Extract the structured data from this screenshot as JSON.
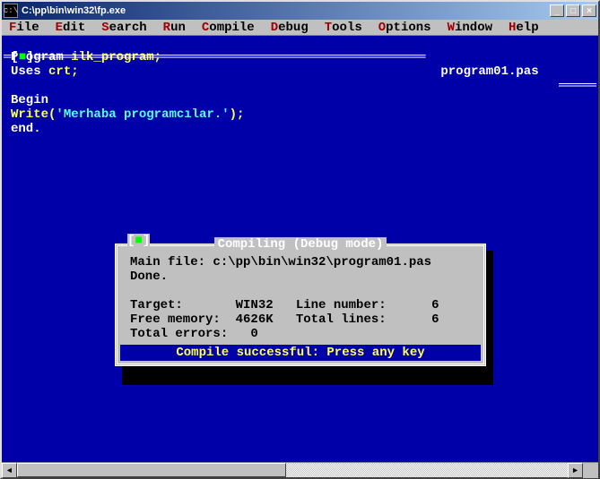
{
  "window": {
    "title": "C:\\pp\\bin\\win32\\fp.exe",
    "icon_label": "c:\\"
  },
  "menu": [
    {
      "hotkey": "F",
      "rest": "ile"
    },
    {
      "hotkey": "E",
      "rest": "dit"
    },
    {
      "hotkey": "S",
      "rest": "earch"
    },
    {
      "hotkey": "R",
      "rest": "un"
    },
    {
      "hotkey": "C",
      "rest": "ompile"
    },
    {
      "hotkey": "D",
      "rest": "ebug"
    },
    {
      "hotkey": "T",
      "rest": "ools"
    },
    {
      "hotkey": "O",
      "rest": "ptions"
    },
    {
      "hotkey": "W",
      "rest": "indow"
    },
    {
      "hotkey": "H",
      "rest": "elp"
    }
  ],
  "editor": {
    "filename": "program01.pas",
    "lines": {
      "l1a": "Program ",
      "l1b": "ilk_program",
      "l1c": ";",
      "l2a": "Uses ",
      "l2b": "crt",
      "l2c": ";",
      "l3": "",
      "l4": "Begin",
      "l5a": "Write",
      "l5b": "(",
      "l5c": "'Merhaba programcılar.'",
      "l5d": ");",
      "l6a": "end",
      "l6b": "."
    }
  },
  "dialog": {
    "title": "Compiling  (Debug mode)",
    "main_file_label": "Main file: ",
    "main_file": "c:\\pp\\bin\\win32\\program01.pas",
    "done": "Done.",
    "target_label": "Target:       ",
    "target": "WIN32",
    "line_label": "   Line number:",
    "line_value": "      6",
    "mem_label": "Free memory:  ",
    "mem": "4626K",
    "total_label": "   Total lines:",
    "total_value": "      6",
    "err_label": "Total errors:   ",
    "err": "0",
    "footer": "Compile successful: Press any key"
  },
  "winbuttons": {
    "min": "_",
    "max": "□",
    "close": "×"
  },
  "scroll": {
    "left": "◄",
    "right": "►"
  }
}
